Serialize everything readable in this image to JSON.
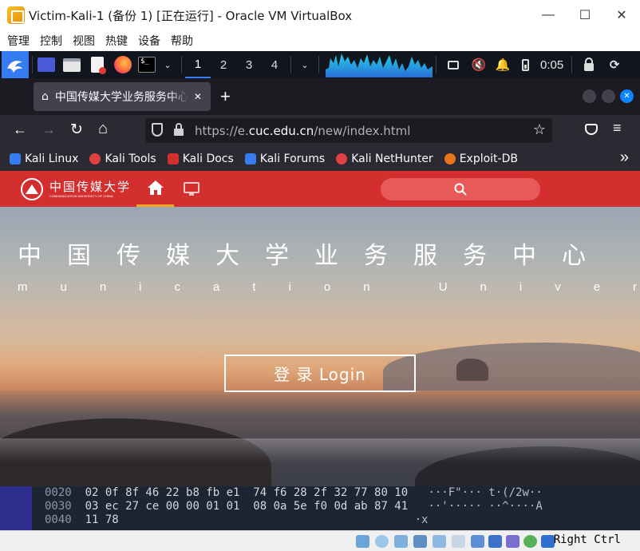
{
  "window": {
    "title": "Victim-Kali-1 (备份 1) [正在运行] - Oracle VM VirtualBox",
    "minimize": "—",
    "maximize": "☐",
    "close": "✕"
  },
  "vb_menu": [
    "管理",
    "控制",
    "视图",
    "热键",
    "设备",
    "帮助"
  ],
  "kali_panel": {
    "workspaces": [
      "1",
      "2",
      "3",
      "4"
    ],
    "clock": "0:05"
  },
  "firefox": {
    "tab_title": "中国传媒大学业务服务中心",
    "tab_close": "✕",
    "new_tab": "+",
    "url_prefix": "https://e.",
    "url_domain": "cuc.edu.cn",
    "url_path": "/new/index.html",
    "bookmarks": [
      {
        "label": "Kali Linux",
        "color": "#367bf0"
      },
      {
        "label": "Kali Tools",
        "color": "#e04141"
      },
      {
        "label": "Kali Docs",
        "color": "#d32f2f"
      },
      {
        "label": "Kali Forums",
        "color": "#367bf0"
      },
      {
        "label": "Kali NetHunter",
        "color": "#e04141"
      },
      {
        "label": "Exploit-DB",
        "color": "#e8741c"
      }
    ],
    "overflow": "»"
  },
  "page": {
    "logo_text": "中国传媒大学",
    "logo_sub": "COMMUNICATION UNIVERSITY OF CHINA",
    "hero_title": "中国传媒大学业务服务中心",
    "hero_subtitle": "munication University Of Chi",
    "login_label": "登 录  Login"
  },
  "hex_rows": [
    {
      "offset": "0020",
      "bytes": "02 0f 8f 46 22 b8 fb e1  74 f6 28 2f 32 77 80 10",
      "ascii": "···F\"··· t·(/2w··"
    },
    {
      "offset": "0030",
      "bytes": "03 ec 27 ce 00 00 01 01  08 0a 5e f0 0d ab 87 41",
      "ascii": "··'····· ··^····A"
    },
    {
      "offset": "0040",
      "bytes": "11 78",
      "ascii": "·x"
    }
  ],
  "status": {
    "host_key": "Right Ctrl"
  },
  "colors": {
    "kali_blue": "#367bf0",
    "cuc_red": "#d32f2f",
    "panel_bg": "#11161e"
  }
}
